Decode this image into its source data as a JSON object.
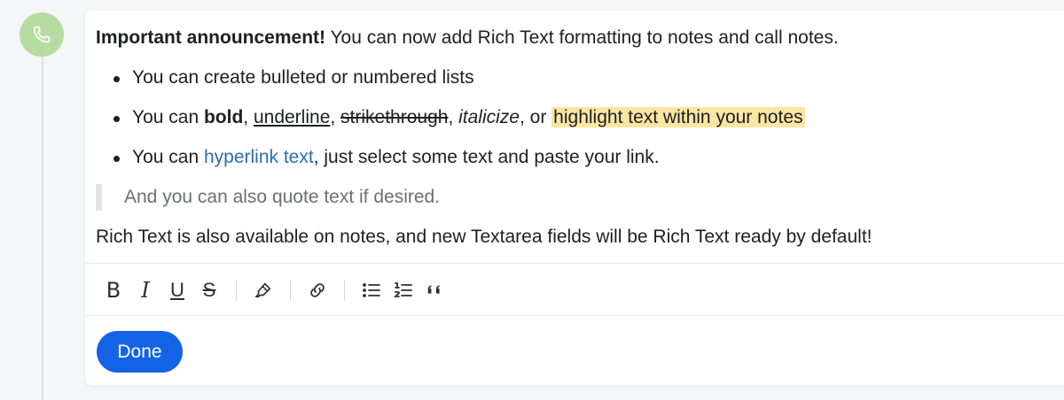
{
  "note": {
    "intro_bold": "Important announcement!",
    "intro_rest": " You can now add Rich Text formatting to notes and call notes.",
    "bullets": {
      "b1": "You can create bulleted or numbered lists",
      "b2": {
        "prefix": "You can ",
        "bold": "bold",
        "c1": ", ",
        "underline": "underline",
        "c2": ", ",
        "strike": "strikethrough",
        "c3": ", ",
        "italic": "italicize",
        "c4": ", or ",
        "highlight": "highlight text within your notes"
      },
      "b3": {
        "prefix": "You can ",
        "link": "hyperlink text",
        "suffix": ", just select some text and paste your link."
      }
    },
    "quote": "And you can also quote text if desired.",
    "closing": "Rich Text is also available on notes, and new Textarea fields will be Rich Text ready by default!"
  },
  "toolbar": {
    "bold_label": "B",
    "italic_label": "I",
    "underline_label": "U",
    "strike_label": "S",
    "icons": [
      "bold-icon",
      "italic-icon",
      "underline-icon",
      "strikethrough-icon",
      "highlighter-icon",
      "link-icon",
      "bulleted-list-icon",
      "numbered-list-icon",
      "quote-icon"
    ]
  },
  "actions": {
    "done_label": "Done"
  },
  "colors": {
    "accent": "#1463e6",
    "highlight": "#fae6a3",
    "link": "#2b6eb3",
    "call_avatar": "#b6dca2"
  }
}
